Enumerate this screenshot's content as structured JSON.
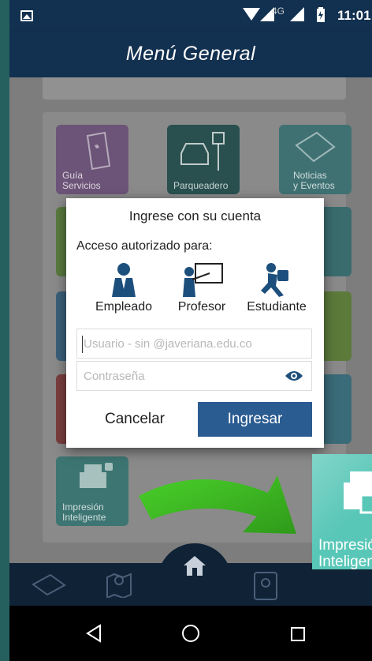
{
  "status_bar": {
    "network": "4G",
    "time": "11:01",
    "icons": [
      "image-icon",
      "wifi-icon",
      "cell-signal-icon",
      "battery-icon"
    ]
  },
  "app_bar": {
    "title": "Menú General"
  },
  "tiles": [
    {
      "label": "Guía Servicios",
      "lines": [
        "Guía",
        "Servicios"
      ],
      "icon": "brochure-icon",
      "color": "#6c5478"
    },
    {
      "label": "Parqueadero",
      "lines": [
        "Parqueadero"
      ],
      "icon": "car-parking-icon",
      "color": "#29504f"
    },
    {
      "label": "Noticias y Eventos",
      "lines": [
        "Noticias",
        "y Eventos"
      ],
      "icon": "newspaper-icon",
      "color": "#3f7173"
    },
    {
      "label": "Impresión Inteligente",
      "lines": [
        "Impresión",
        "Inteligente"
      ],
      "icon": "printer-lock-icon",
      "color": "#3d7572"
    }
  ],
  "dialog": {
    "title": "Ingrese con su cuenta",
    "subtitle": "Acceso autorizado para:",
    "roles": [
      {
        "label": "Empleado",
        "icon": "employee-icon"
      },
      {
        "label": "Profesor",
        "icon": "teacher-icon"
      },
      {
        "label": "Estudiante",
        "icon": "student-icon"
      }
    ],
    "username_placeholder": "Usuario - sin @javeriana.edu.co",
    "username_value": "",
    "password_placeholder": "Contraseña",
    "password_value": "",
    "cancel_label": "Cancelar",
    "login_label": "Ingresar",
    "accent_color": "#2b5c91"
  },
  "callout": {
    "lines": [
      "Impresión",
      "Inteligente"
    ],
    "color": "#59c7b7"
  },
  "bottom_nav": {
    "items": [
      "newspaper-icon",
      "map-icon",
      "home-icon",
      "contacts-icon"
    ]
  },
  "system_nav": {
    "items": [
      "back-icon",
      "home-circle-icon",
      "recents-icon"
    ]
  }
}
